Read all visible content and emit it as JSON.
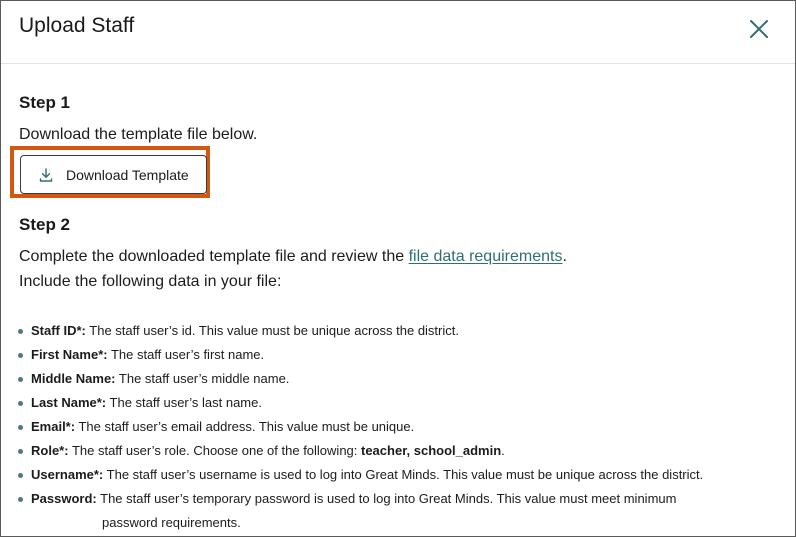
{
  "dialog": {
    "title": "Upload Staff",
    "close_icon": "close-icon"
  },
  "step1": {
    "title": "Step 1",
    "instruction": "Download the template file below.",
    "download_button": {
      "icon": "download-icon",
      "label": "Download Template"
    }
  },
  "step2": {
    "title": "Step 2",
    "instruction_prefix": "Complete the downloaded template file and review the ",
    "link_text": "file data requirements",
    "instruction_suffix": ".",
    "include_text": "Include the following data in your file:"
  },
  "requirements": [
    {
      "field": "Staff ID*:",
      "desc": " The staff user’s id. This value must be unique across the district."
    },
    {
      "field": "First Name*:",
      "desc": " The staff user’s first name."
    },
    {
      "field": "Middle Name:",
      "desc": " The staff user’s middle name."
    },
    {
      "field": "Last Name*:",
      "desc": " The staff user’s last name."
    },
    {
      "field": "Email*:",
      "desc": " The staff user’s email address. This value must be unique."
    },
    {
      "field": "Role*:",
      "desc": " The staff user’s role. Choose one of the following: ",
      "emph": "teacher, school_admin",
      "after": "."
    },
    {
      "field": "Username*:",
      "desc": " The staff user’s username is used to log into Great Minds. This value must be unique across the district."
    },
    {
      "field": "Password:",
      "desc": " The staff user’s temporary password is used to log into Great Minds. This value must meet minimum",
      "desc_line2": "password requirements."
    }
  ],
  "colors": {
    "highlight": "#d3580f",
    "link": "#2f6f73",
    "bullet": "#4d7a80"
  }
}
